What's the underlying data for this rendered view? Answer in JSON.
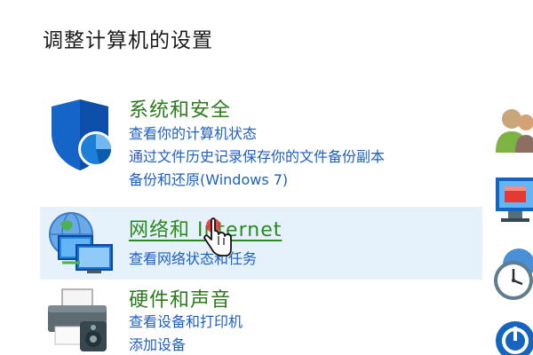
{
  "page": {
    "title": "调整计算机的设置"
  },
  "categories": [
    {
      "id": "security",
      "title": "系统和安全",
      "icon": "shield-icon",
      "links": [
        "查看你的计算机状态",
        "通过文件历史记录保存你的文件备份副本",
        "备份和还原(Windows 7)"
      ]
    },
    {
      "id": "network",
      "title": "网络和 Internet",
      "icon": "network-icon",
      "hovered": true,
      "links": [
        "查看网络状态和任务"
      ]
    },
    {
      "id": "hardware",
      "title": "硬件和声音",
      "icon": "printer-icon",
      "links": [
        "查看设备和打印机",
        "添加设备"
      ]
    }
  ],
  "right_column_icons": [
    "user-accounts-icon",
    "appearance-icon",
    "clock-icon",
    "ease-of-access-icon"
  ],
  "colors": {
    "category_title": "#2a7c1a",
    "link": "#1f5fbf",
    "hover_background": "#e5f1fb"
  }
}
